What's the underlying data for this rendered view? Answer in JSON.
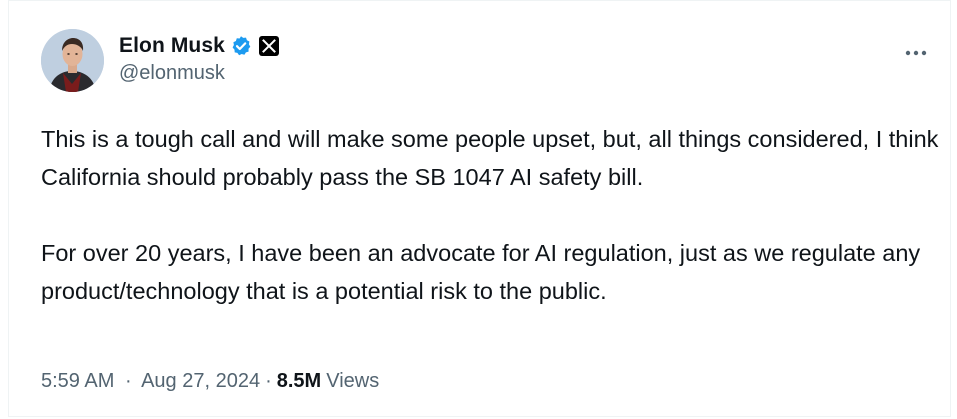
{
  "author": {
    "display_name": "Elon Musk",
    "handle": "@elonmusk",
    "verified_icon": "verified-badge-icon",
    "affiliate_icon": "x-logo-icon",
    "verified_color": "#1d9bf0"
  },
  "tweet": {
    "paragraph_1": "This is a tough call and will make some people upset, but, all things considered, I think California should probably pass the SB 1047 AI safety bill.",
    "paragraph_2": "For over 20 years, I have been an advocate for AI regulation, just as we regulate any product/technology that is a potential risk to the public."
  },
  "meta": {
    "time": "5:59 AM",
    "separator": "·",
    "date": "Aug 27, 2024",
    "views_count": "8.5M",
    "views_label": "Views"
  },
  "menu": {
    "more_icon": "more-horizontal-icon"
  }
}
